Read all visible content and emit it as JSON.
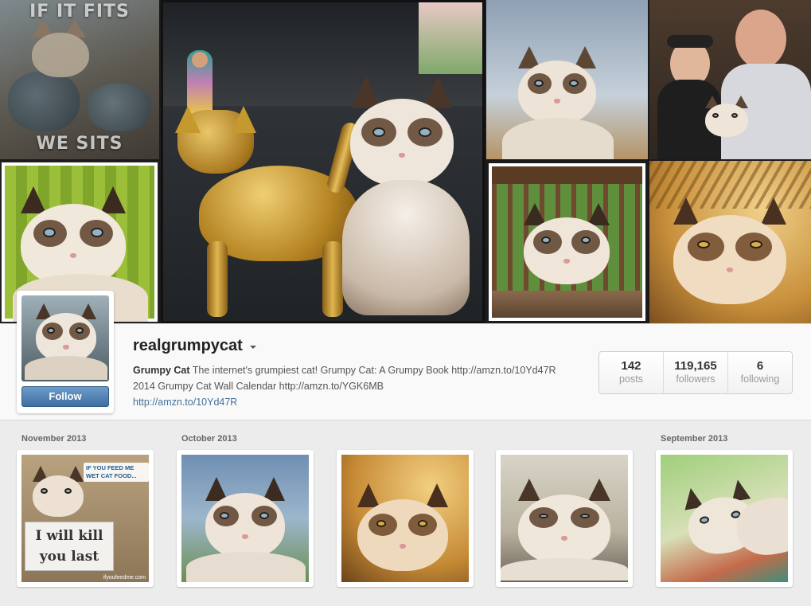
{
  "cover": {
    "tiles": [
      {
        "name": "cover-tile-if-it-fits",
        "caption_top": "IF IT FITS",
        "caption_bottom": "WE SITS"
      },
      {
        "name": "cover-tile-golden-cat"
      },
      {
        "name": "cover-tile-sky"
      },
      {
        "name": "cover-tile-with-people"
      },
      {
        "name": "cover-tile-green"
      },
      {
        "name": "cover-tile-fence"
      },
      {
        "name": "cover-tile-palm"
      }
    ]
  },
  "profile": {
    "username": "realgrumpycat",
    "follow_label": "Follow",
    "bio_name": "Grumpy Cat",
    "bio_text": "The internet's grumpiest cat! Grumpy Cat: A Grumpy Book http://amzn.to/10Yd47R 2014 Grumpy Cat Wall Calendar http://amzn.to/YGK6MB",
    "bio_link": "http://amzn.to/10Yd47R",
    "stats": [
      {
        "value": "142",
        "label": "posts"
      },
      {
        "value": "119,165",
        "label": "followers"
      },
      {
        "value": "6",
        "label": "following"
      }
    ]
  },
  "grid": {
    "months": [
      "November 2013",
      "October 2013",
      "September 2013"
    ],
    "photos": [
      {
        "name": "photo-1",
        "caption_top": "IF YOU FEED ME WET CAT FOOD...",
        "caption_sign": "I will kill you last",
        "credit": "ifyoufeedme.com"
      },
      {
        "name": "photo-2"
      },
      {
        "name": "photo-3"
      },
      {
        "name": "photo-4"
      },
      {
        "name": "photo-5"
      }
    ]
  },
  "colors": {
    "follow_button": "#3f6f9f",
    "link": "#3f729b"
  }
}
